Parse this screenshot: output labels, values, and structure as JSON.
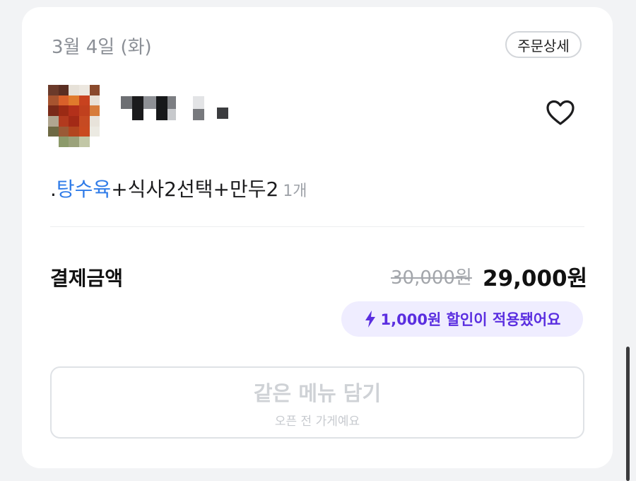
{
  "order": {
    "date": "3월 4일 (화)",
    "detail_button": "주문상세",
    "store_icon": "heart-outline-icon",
    "menu_highlight": "탕수육",
    "menu_prefix": ".",
    "menu_rest": "+식사2선택+만두2",
    "quantity": "1개"
  },
  "payment": {
    "label": "결제금액",
    "original_price": "30,000원",
    "final_price": "29,000원",
    "discount_icon": "lightning-bolt-icon",
    "discount_text": "1,000원 할인이 적용됐어요"
  },
  "reorder": {
    "title": "같은 메뉴 담기",
    "subtitle": "오픈 전 가게예요"
  },
  "colors": {
    "accent_blue": "#2f7be8",
    "discount_purple": "#5a2ee0",
    "discount_bg": "#efedff"
  }
}
